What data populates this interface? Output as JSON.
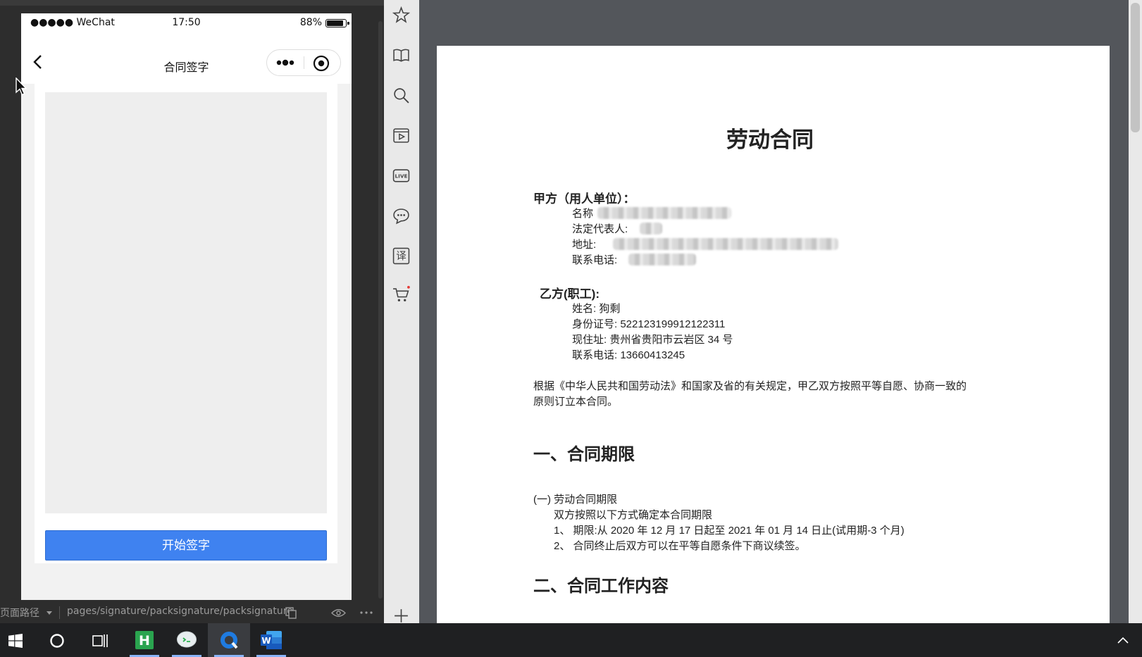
{
  "simulator": {
    "status_bar": {
      "signal": "●●●●● WeChat",
      "time": "17:50",
      "battery": "88%",
      "battery_level": 0.88
    },
    "nav": {
      "title": "合同签字"
    },
    "sign_button": "开始签字"
  },
  "path_bar": {
    "label": "页面路径",
    "value": "pages/signature/packsignature/packsignature"
  },
  "toolbar": {
    "icons": [
      "star-icon",
      "book-icon",
      "search-icon",
      "video-icon",
      "live-icon",
      "chat-icon",
      "translate-icon",
      "cart-icon",
      "plus-icon"
    ],
    "live_label": "LIVE",
    "translate_label": "译",
    "cart_badge_color": "#e53935"
  },
  "document": {
    "title": "劳动合同",
    "party_a": {
      "heading": "甲方（用人单位）：",
      "name_label": "名称",
      "rep_label": "法定代表人:",
      "address_label": "地址:",
      "phone_label": "联系电话:"
    },
    "party_b": {
      "heading": "乙方(职工):",
      "name": "姓名: 狗剩",
      "id": "身份证号: 522123199912122311",
      "address": "现住址: 贵州省贵阳市云岩区 34 号",
      "phone": "联系电话: 13660413245"
    },
    "preamble_1": "根据《中华人民共和国劳动法》和国家及省的有关规定，甲乙双方按照平等自愿、协商一致的",
    "preamble_2": "原则订立本合同。",
    "section1": {
      "heading": "一、合同期限",
      "sub": "(一) 劳动合同期限",
      "line1": "双方按照以下方式确定本合同期限",
      "line2": "1、 期限:从 2020 年 12 月 17 日起至 2021 年 01 月 14 日止(试用期-3 个月)",
      "line3": "2、 合同终止后双方可以在平等自愿条件下商议续签。"
    },
    "section2": {
      "heading": "二、合同工作内容"
    }
  },
  "taskbar": {
    "apps": [
      "windows-start-icon",
      "cortana-icon",
      "task-view-icon",
      "hbuilder-icon",
      "wechat-devtools-icon",
      "browser-icon",
      "word-icon"
    ],
    "hbuilder_letter": "H",
    "word_letter": "W"
  },
  "colors": {
    "primary_button": "#3f82f0",
    "page_bg": "#53565b",
    "taskbar": "#1f2022"
  }
}
